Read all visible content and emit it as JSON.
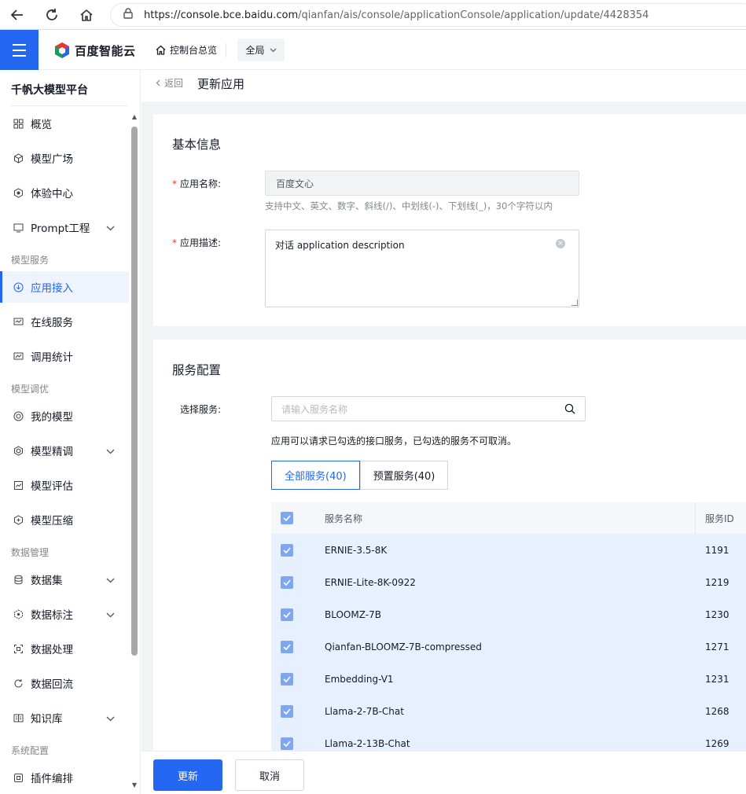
{
  "browser": {
    "url_host": "https://console.bce.baidu.com",
    "url_path": "/qianfan/ais/console/applicationConsole/application/update/4428354"
  },
  "topnav": {
    "brand": "百度智能云",
    "console_home": "控制台总览",
    "scope": "全局"
  },
  "sidebar": {
    "title": "千帆大模型平台",
    "items": [
      {
        "label": "概览",
        "icon": "grid-icon"
      },
      {
        "label": "模型广场",
        "icon": "cube-icon"
      },
      {
        "label": "体验中心",
        "icon": "hexagon-icon"
      },
      {
        "label": "Prompt工程",
        "icon": "prompt-icon"
      },
      {
        "label": "应用接入",
        "icon": "download-icon"
      },
      {
        "label": "在线服务",
        "icon": "monitor-icon"
      },
      {
        "label": "调用统计",
        "icon": "chart-icon"
      },
      {
        "label": "我的模型",
        "icon": "model-icon"
      },
      {
        "label": "模型精调",
        "icon": "tune-icon"
      },
      {
        "label": "模型评估",
        "icon": "evaluate-icon"
      },
      {
        "label": "模型压缩",
        "icon": "compress-icon"
      },
      {
        "label": "数据集",
        "icon": "database-icon"
      },
      {
        "label": "数据标注",
        "icon": "annotate-icon"
      },
      {
        "label": "数据处理",
        "icon": "process-icon"
      },
      {
        "label": "数据回流",
        "icon": "reflow-icon"
      },
      {
        "label": "知识库",
        "icon": "book-icon"
      },
      {
        "label": "插件编排",
        "icon": "plugin-icon"
      }
    ],
    "groups": [
      "模型服务",
      "模型调优",
      "数据管理",
      "系统配置"
    ]
  },
  "page": {
    "back": "返回",
    "title": "更新应用"
  },
  "basic": {
    "title": "基本信息",
    "name_label": "应用名称:",
    "name_value": "百度文心",
    "name_hint": "支持中文、英文、数字、斜线(/)、中划线(-)、下划线(_)，30个字符以内",
    "desc_label": "应用描述:",
    "desc_value": "对话 application description"
  },
  "service": {
    "title": "服务配置",
    "select_label": "选择服务:",
    "search_placeholder": "请输入服务名称",
    "note": "应用可以请求已勾选的接口服务，已勾选的服务不可取消。",
    "tabs": [
      "全部服务(40)",
      "预置服务(40)"
    ],
    "columns": [
      "服务名称",
      "服务ID"
    ],
    "rows": [
      {
        "name": "ERNIE-3.5-8K",
        "id": "1191"
      },
      {
        "name": "ERNIE-Lite-8K-0922",
        "id": "1219"
      },
      {
        "name": "BLOOMZ-7B",
        "id": "1230"
      },
      {
        "name": "Qianfan-BLOOMZ-7B-compressed",
        "id": "1271"
      },
      {
        "name": "Embedding-V1",
        "id": "1231"
      },
      {
        "name": "Llama-2-7B-Chat",
        "id": "1268"
      },
      {
        "name": "Llama-2-13B-Chat",
        "id": "1269"
      }
    ]
  },
  "footer": {
    "update": "更新",
    "cancel": "取消"
  },
  "colors": {
    "accent": "#2468f2",
    "row_selected": "#e6f0fe",
    "required": "#e8372f"
  }
}
